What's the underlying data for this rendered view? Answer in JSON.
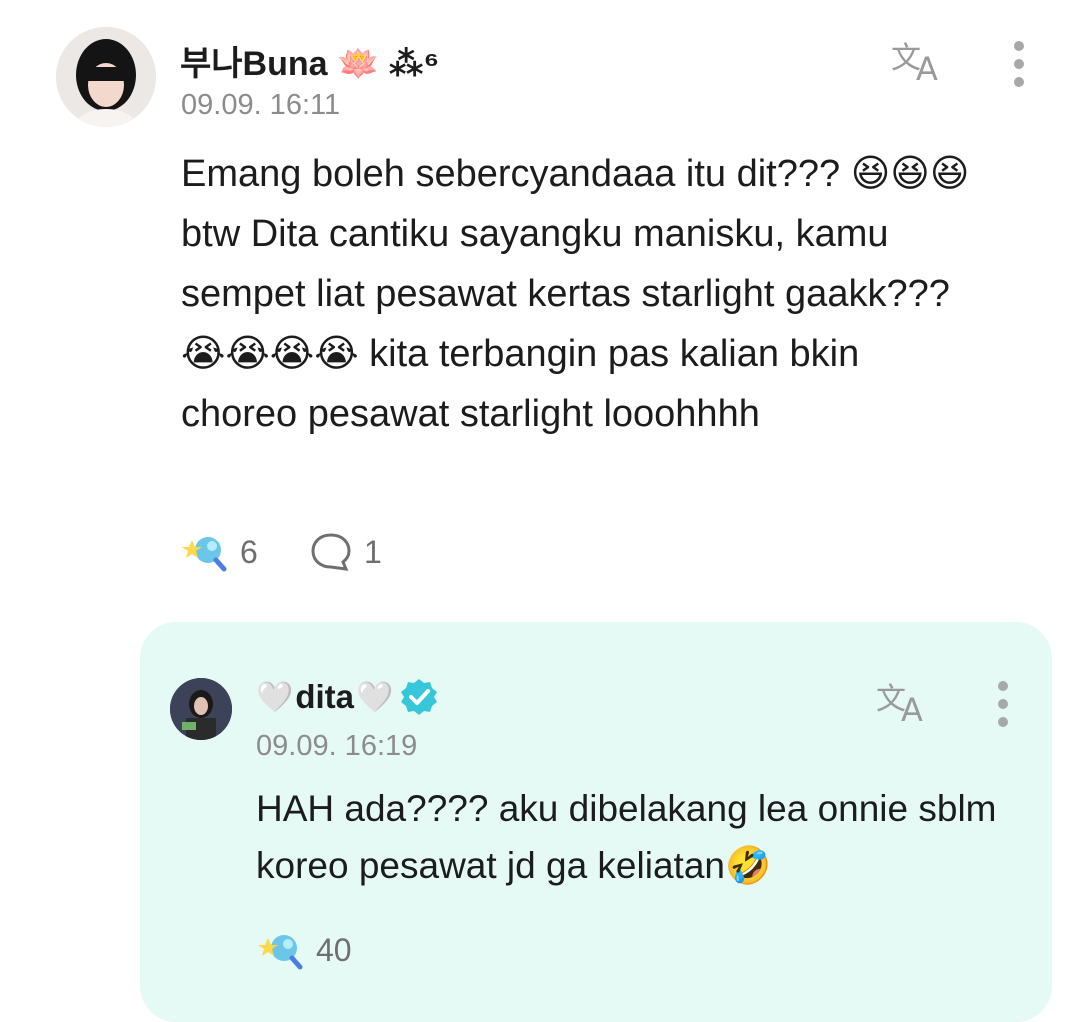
{
  "comment": {
    "username": "부나Buna 🪷 ⁂⁶",
    "timestamp": "09.09. 16:11",
    "text": "Emang boleh sebercyandaaa itu dit??? 😆😆😆 btw Dita cantiku sayangku manisku, kamu sempet liat pesawat kertas starlight gaakk??? 😭😭😭😭 kita terbangin pas kalian bkin choreo pesawat starlight looohhhh",
    "like_count": "6",
    "reply_count": "1",
    "translate_icon": "translate-icon",
    "more_icon": "more-vertical-icon"
  },
  "reply": {
    "username_prefix": "🤍",
    "username": "dita",
    "username_suffix": "🤍",
    "verified": true,
    "timestamp": "09.09. 16:19",
    "text": " HAH ada???? aku dibelakang lea onnie sblm koreo pesawat jd ga keliatan🤣",
    "like_count": "40",
    "background": "#e6faf5",
    "accent": "#36c8d9"
  }
}
